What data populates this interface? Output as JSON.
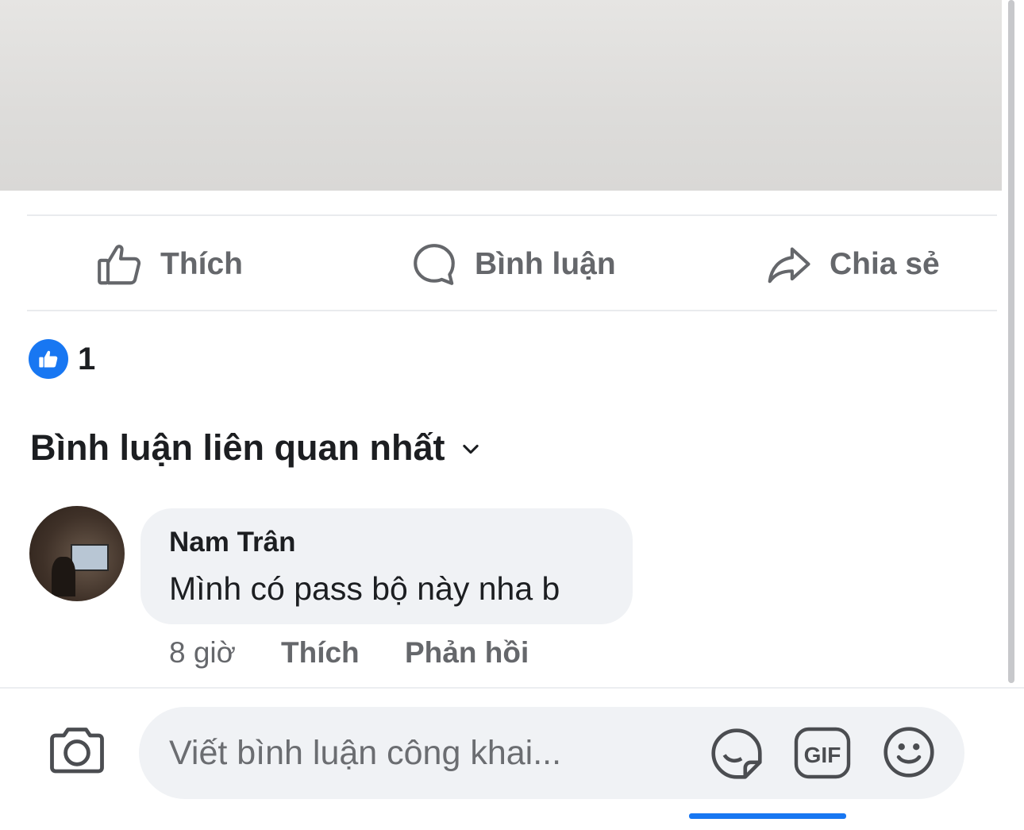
{
  "actions": {
    "like": "Thích",
    "comment": "Bình luận",
    "share": "Chia sẻ"
  },
  "reactions": {
    "count": "1"
  },
  "comments_sort": {
    "label": "Bình luận liên quan nhất"
  },
  "comment": {
    "author": "Nam Trân",
    "text": "Mình có pass bộ này nha b",
    "time": "8 giờ",
    "like_label": "Thích",
    "reply_label": "Phản hồi"
  },
  "composer": {
    "placeholder": "Viết bình luận công khai...",
    "gif_label": "GIF"
  },
  "colors": {
    "accent": "#1877f2",
    "muted_text": "#65676b",
    "bubble": "#f0f2f5"
  }
}
